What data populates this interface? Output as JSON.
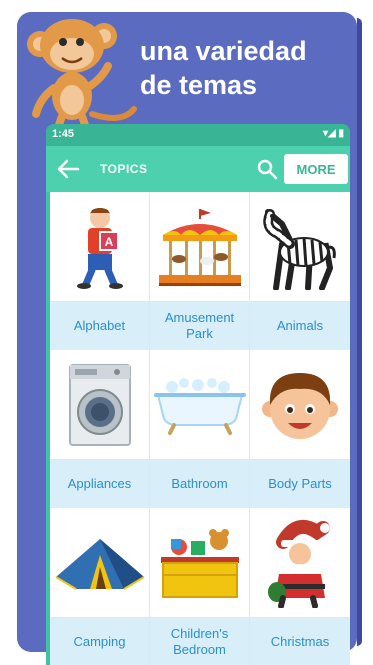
{
  "promo": {
    "headline_line1": "una variedad",
    "headline_line2": "de temas"
  },
  "status_bar": {
    "time": "1:45",
    "icons": "▾◢ ▮"
  },
  "app_bar": {
    "back_icon": "arrow-left-icon",
    "title": "TOPICS",
    "search_icon": "search-icon",
    "more_label": "MORE"
  },
  "colors": {
    "card_background": "#5b6bbf",
    "app_bar": "#4cd0ad",
    "label_background": "#d8eef8",
    "label_text": "#2b8fd0"
  },
  "topics": [
    {
      "label": "Alphabet",
      "icon": "boy-with-letter-block"
    },
    {
      "label": "Amusement Park",
      "icon": "carousel"
    },
    {
      "label": "Animals",
      "icon": "zebra"
    },
    {
      "label": "Appliances",
      "icon": "washing-machine"
    },
    {
      "label": "Bathroom",
      "icon": "bathtub"
    },
    {
      "label": "Body Parts",
      "icon": "boy-face"
    },
    {
      "label": "Camping",
      "icon": "tent"
    },
    {
      "label": "Children's Bedroom",
      "icon": "toy-box"
    },
    {
      "label": "Christmas",
      "icon": "santa-claus"
    }
  ]
}
